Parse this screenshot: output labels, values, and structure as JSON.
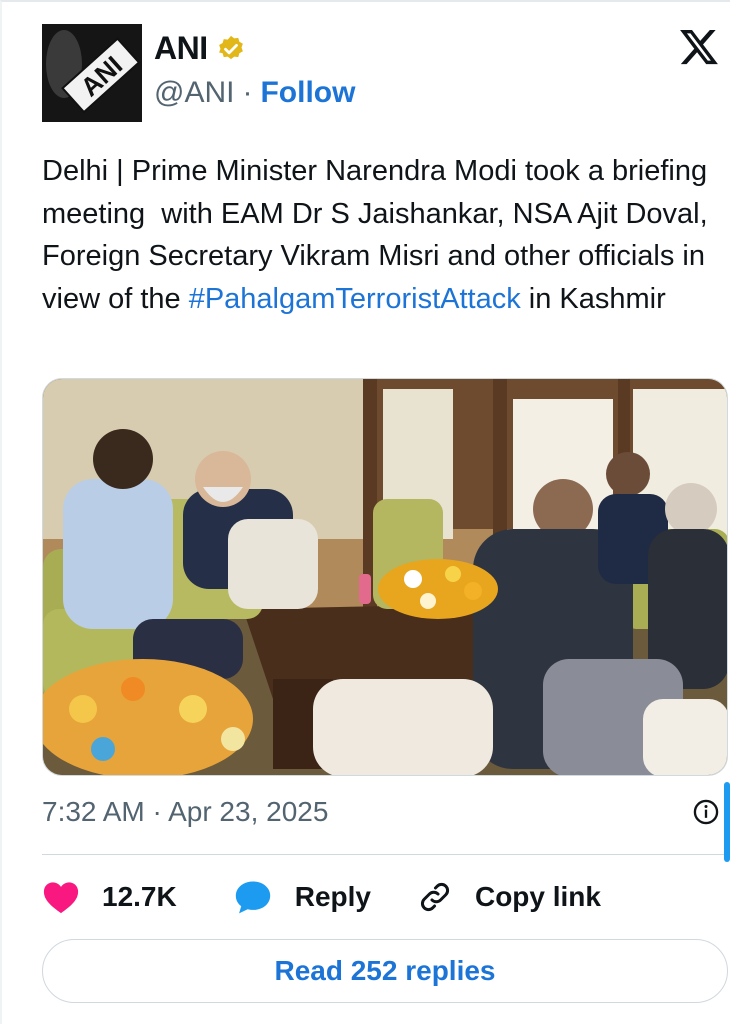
{
  "author": {
    "display_name": "ANI",
    "handle": "@ANI",
    "separator": "·",
    "follow_label": "Follow",
    "avatar_logo_text": "ANI",
    "verified": true
  },
  "tweet": {
    "text_before": "Delhi | Prime Minister Narendra Modi took a briefing meeting  with EAM Dr S Jaishankar, NSA Ajit Doval, Foreign Secretary Vikram Misri and other officials in view of the ",
    "hashtag": "#PahalgamTerroristAttack",
    "text_after": " in Kashmir",
    "timestamp": "7:32 AM · Apr 23, 2025"
  },
  "actions": {
    "like_count": "12.7K",
    "reply_label": "Reply",
    "copy_link_label": "Copy link"
  },
  "read_replies_label": "Read 252 replies",
  "colors": {
    "accent": "#1d74d7",
    "like": "#f91880",
    "reply": "#1d9bf0",
    "verified_gold": "#e2b719",
    "muted": "#536471"
  }
}
